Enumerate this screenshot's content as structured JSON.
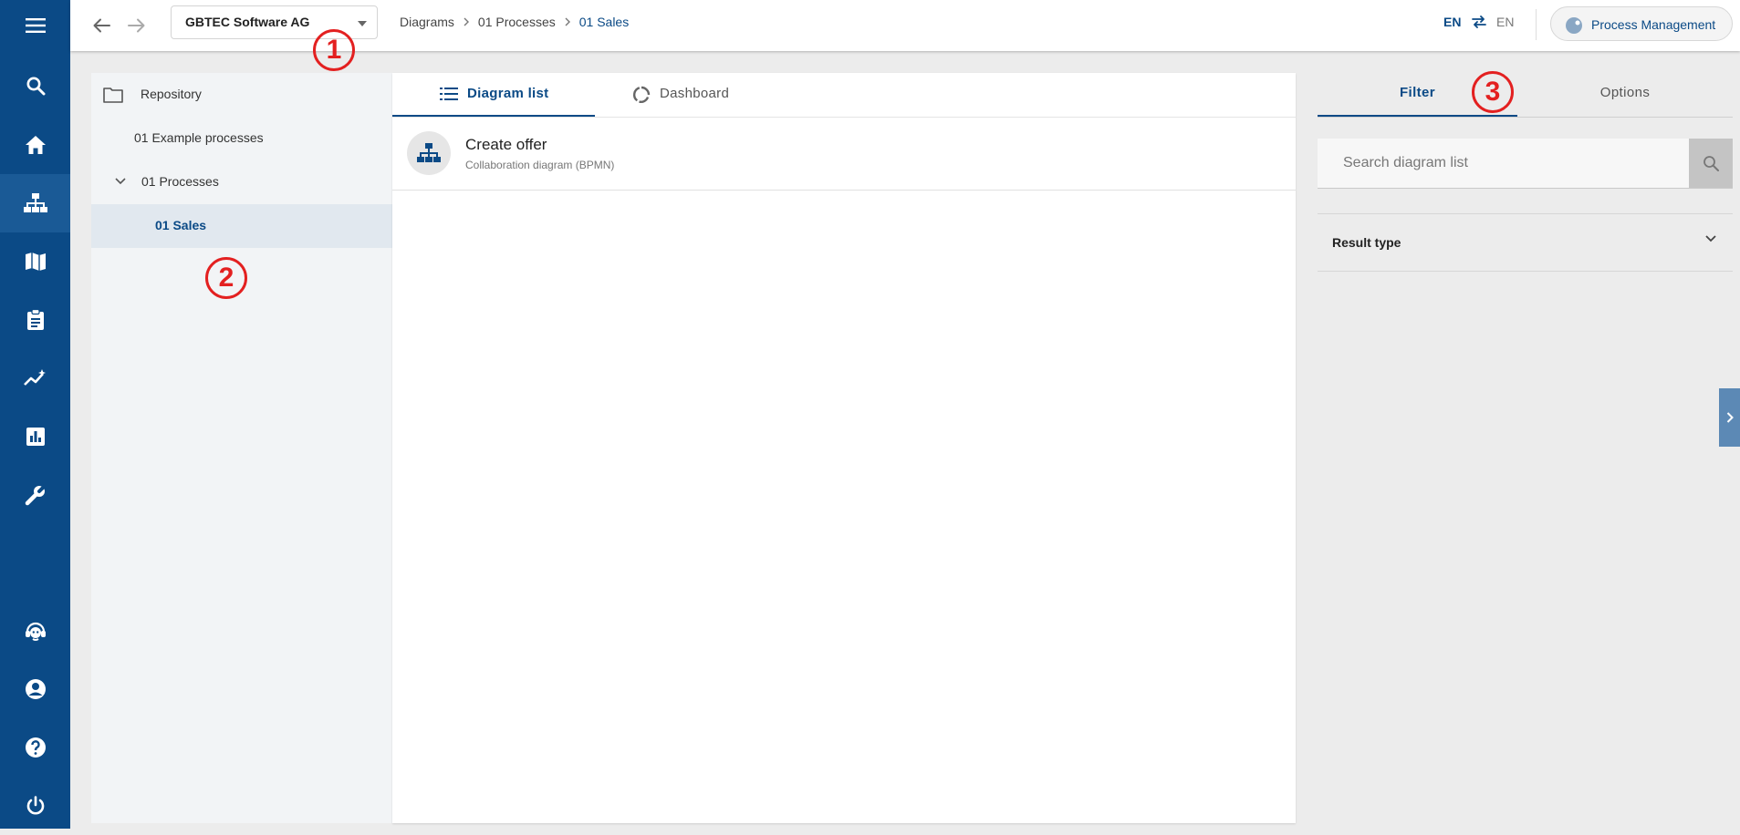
{
  "header": {
    "company_select": "GBTEC Software AG",
    "breadcrumbs": [
      "Diagrams",
      "01 Processes",
      "01 Sales"
    ],
    "language_from": "EN",
    "language_to": "EN",
    "module_button": "Process Management"
  },
  "sidebar": {
    "icons": [
      "menu-icon",
      "search-icon",
      "home-icon",
      "sitemap-icon",
      "map-icon",
      "clipboard-icon",
      "analytics-icon",
      "report-icon",
      "wrench-icon",
      "support-icon",
      "account-icon",
      "help-icon",
      "power-icon"
    ],
    "active": "sitemap-icon"
  },
  "tree": {
    "root": "Repository",
    "items": [
      {
        "label": "01 Example processes"
      },
      {
        "label": "01 Processes",
        "expanded": true
      },
      {
        "label": "01 Sales",
        "selected": true
      }
    ]
  },
  "content": {
    "tabs": [
      {
        "label": "Diagram list",
        "icon": "list-icon",
        "active": true
      },
      {
        "label": "Dashboard",
        "icon": "dashboard-icon"
      }
    ],
    "diagrams": [
      {
        "title": "Create offer",
        "subtitle": "Collaboration diagram (BPMN)",
        "icon": "sitemap-icon"
      }
    ]
  },
  "filter_panel": {
    "tabs": [
      {
        "label": "Filter",
        "active": true
      },
      {
        "label": "Options"
      }
    ],
    "search_placeholder": "Search diagram list",
    "sections": [
      {
        "label": "Result type",
        "icon": "chevron-down-icon"
      }
    ]
  },
  "annotations": [
    "1",
    "2",
    "3"
  ],
  "colors": {
    "primary": "#0b4a86",
    "marker": "#e32020"
  }
}
